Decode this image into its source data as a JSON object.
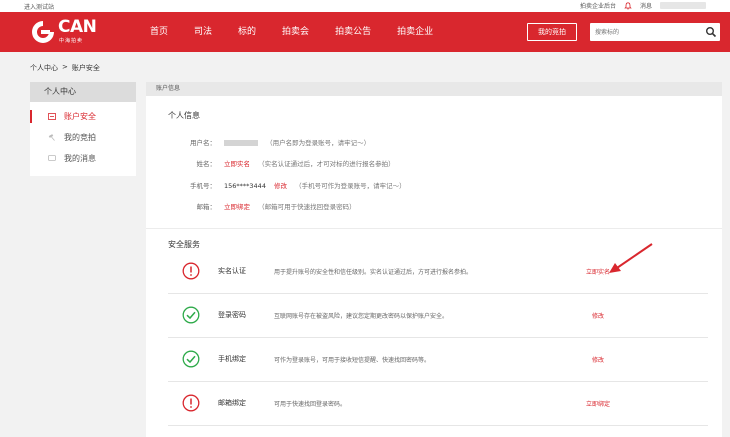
{
  "topbar": {
    "left_text": "进入测试站",
    "links": [
      "拍卖企业后台",
      "消息"
    ]
  },
  "logo": {
    "text": "CAN",
    "sub": "中海拍卖"
  },
  "nav": {
    "items": [
      "首页",
      "司法",
      "标的",
      "拍卖会",
      "拍卖公告",
      "拍卖企业"
    ],
    "my_bid": "我的竞拍",
    "search_placeholder": "搜索标的"
  },
  "breadcrumb": {
    "parent": "个人中心",
    "sep": ">",
    "current": "账户安全"
  },
  "sidebar": {
    "title": "个人中心",
    "items": [
      {
        "label": "账户安全",
        "icon": "shield-icon"
      },
      {
        "label": "我的竞拍",
        "icon": "gavel-icon"
      },
      {
        "label": "我的消息",
        "icon": "message-icon"
      }
    ]
  },
  "main": {
    "header": "账户信息",
    "personal": {
      "title": "个人信息",
      "username": {
        "label": "用户名：",
        "hint": "（用户名即为登录账号，请牢记～）"
      },
      "name": {
        "label": "姓名：",
        "link": "立即实名",
        "hint": "（实名认证通过后，才可对标的进行报名参拍）"
      },
      "phone": {
        "label": "手机号：",
        "value": "156****3444",
        "link": "修改",
        "hint": "（手机号可作为登录账号，请牢记～）"
      },
      "email": {
        "label": "邮箱：",
        "link": "立即绑定",
        "hint": "（邮箱可用于快速找回登录密码）"
      }
    },
    "security": {
      "title": "安全服务",
      "items": [
        {
          "name": "实名认证",
          "desc": "用于提升账号的安全性和信任级别。实名认证通过后，方可进行报名参拍。",
          "action": "立即实名",
          "status": "warning",
          "icon": "alert-icon"
        },
        {
          "name": "登录密码",
          "desc": "互联网账号存在被盗风险，建议您定期更改密码以保护账户安全。",
          "action": "修改",
          "status": "ok",
          "icon": "check-icon"
        },
        {
          "name": "手机绑定",
          "desc": "可作为登录账号，可用于接收短信提醒、快速找回密码等。",
          "action": "修改",
          "status": "ok",
          "icon": "check-icon"
        },
        {
          "name": "邮箱绑定",
          "desc": "可用于快速找回登录密码。",
          "action": "立即绑定",
          "status": "warning",
          "icon": "alert-icon"
        }
      ]
    }
  },
  "colors": {
    "brand": "#d9272e",
    "ok": "#2eaa4a"
  }
}
